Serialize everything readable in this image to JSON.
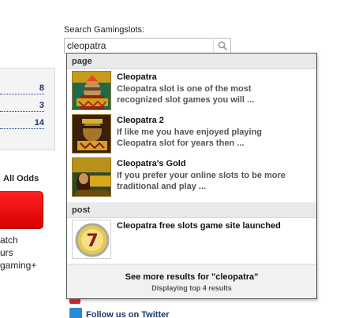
{
  "left": {
    "counts": [
      "8",
      "3",
      "14"
    ],
    "all_odds": "All Odds",
    "lines": [
      "atch",
      "urs",
      "gaming+"
    ]
  },
  "search": {
    "label": "Search Gamingslots:",
    "value": "cleopatra",
    "button_icon": "search-icon"
  },
  "dropdown": {
    "sections": [
      {
        "heading": "page",
        "results": [
          {
            "title": "Cleopatra",
            "desc": "Cleopatra slot is one of the most recognized slot games you will ..."
          },
          {
            "title": "Cleopatra 2",
            "desc": "If like me you have enjoyed playing Cleopatra slot for years then ..."
          },
          {
            "title": "Cleopatra's Gold",
            "desc": "If you prefer your online slots to be more traditional and play ..."
          }
        ]
      },
      {
        "heading": "post",
        "results": [
          {
            "title": "Cleopatra free slots game site launched",
            "desc": ""
          }
        ]
      }
    ],
    "see_more": "See more results for \"cleopatra\"",
    "displaying": "Displaying top 4 results"
  },
  "bottom": {
    "twitter": "Follow us on Twitter"
  },
  "colors": {
    "accent_red": "#e00000",
    "link_navy": "#1a2e6e"
  }
}
